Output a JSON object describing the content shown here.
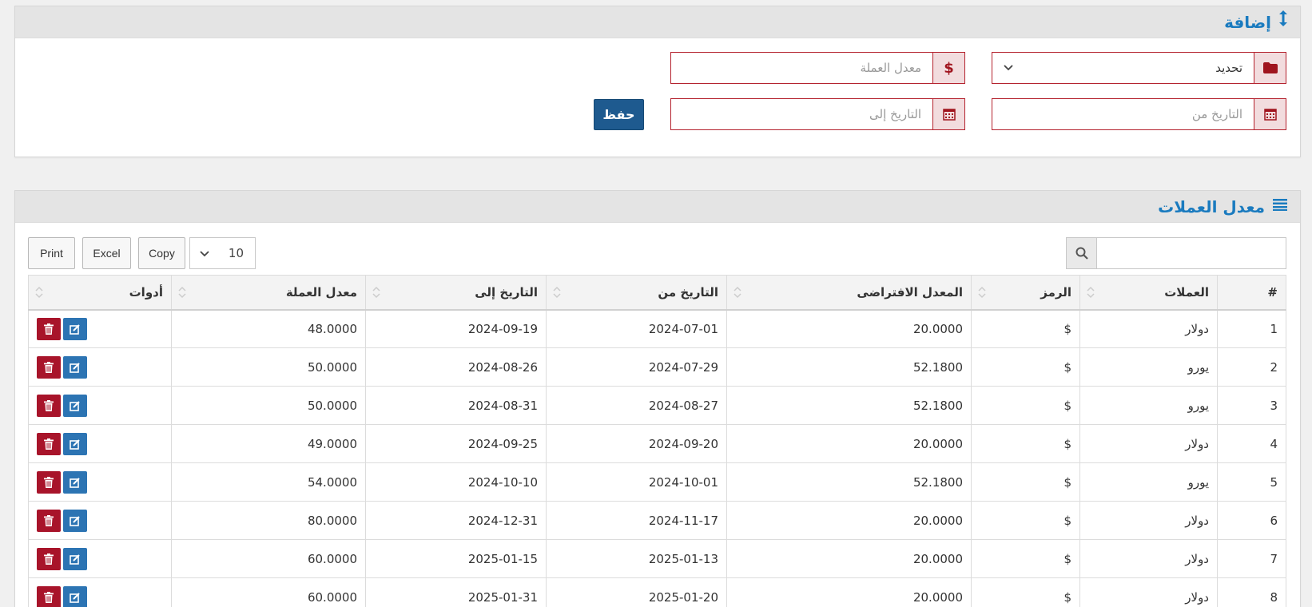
{
  "add_panel": {
    "title": "إضافة",
    "currency_select": {
      "value": "تحديد"
    },
    "rate_field": {
      "placeholder": "معدل العملة",
      "addon": "$"
    },
    "date_from_field": {
      "placeholder": "التاريخ من"
    },
    "date_to_field": {
      "placeholder": "التاريخ إلى"
    },
    "save_label": "حفظ"
  },
  "list_panel": {
    "title": "معدل العملات",
    "page_length": "10",
    "buttons": {
      "print": "Print",
      "excel": "Excel",
      "copy": "Copy"
    },
    "columns": [
      "#",
      "العملات",
      "الرمز",
      "المعدل الافتراضى",
      "التاريخ من",
      "التاريخ إلى",
      "معدل العملة",
      "أدوات"
    ],
    "rows": [
      {
        "n": "1",
        "currency": "دولار",
        "symbol": "$",
        "default_rate": "20.0000",
        "from": "2024-07-01",
        "to": "2024-09-19",
        "rate": "48.0000"
      },
      {
        "n": "2",
        "currency": "يورو",
        "symbol": "$",
        "default_rate": "52.1800",
        "from": "2024-07-29",
        "to": "2024-08-26",
        "rate": "50.0000"
      },
      {
        "n": "3",
        "currency": "يورو",
        "symbol": "$",
        "default_rate": "52.1800",
        "from": "2024-08-27",
        "to": "2024-08-31",
        "rate": "50.0000"
      },
      {
        "n": "4",
        "currency": "دولار",
        "symbol": "$",
        "default_rate": "20.0000",
        "from": "2024-09-20",
        "to": "2024-09-25",
        "rate": "49.0000"
      },
      {
        "n": "5",
        "currency": "يورو",
        "symbol": "$",
        "default_rate": "52.1800",
        "from": "2024-10-01",
        "to": "2024-10-10",
        "rate": "54.0000"
      },
      {
        "n": "6",
        "currency": "دولار",
        "symbol": "$",
        "default_rate": "20.0000",
        "from": "2024-11-17",
        "to": "2024-12-31",
        "rate": "80.0000"
      },
      {
        "n": "7",
        "currency": "دولار",
        "symbol": "$",
        "default_rate": "20.0000",
        "from": "2025-01-13",
        "to": "2025-01-15",
        "rate": "60.0000"
      },
      {
        "n": "8",
        "currency": "دولار",
        "symbol": "$",
        "default_rate": "20.0000",
        "from": "2025-01-20",
        "to": "2025-01-31",
        "rate": "60.0000"
      }
    ]
  },
  "icons": {
    "add_panel": "arrows-vertical-icon",
    "list_panel": "list-icon",
    "folder": "folder-icon",
    "calendar": "calendar-icon",
    "search": "search-icon",
    "edit": "edit-icon",
    "delete": "trash-icon"
  },
  "colors": {
    "accent": "#1a7bbf",
    "danger": "#a8142a",
    "primary": "#2c74b3",
    "save": "#1e5a8f"
  }
}
